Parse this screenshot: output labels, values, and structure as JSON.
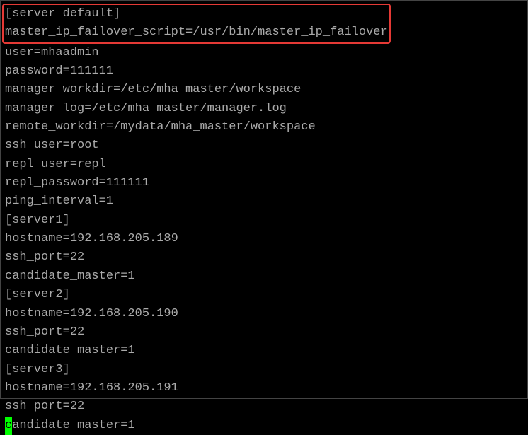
{
  "lines": {
    "l00": "[server default]",
    "l01": "master_ip_failover_script=/usr/bin/master_ip_failover",
    "l02": "user=mhaadmin",
    "l03": "password=111111",
    "l04": "manager_workdir=/etc/mha_master/workspace",
    "l05": "manager_log=/etc/mha_master/manager.log",
    "l06": "remote_workdir=/mydata/mha_master/workspace",
    "l07": "ssh_user=root",
    "l08": "repl_user=repl",
    "l09": "repl_password=111111",
    "l10": "ping_interval=1",
    "l11": "[server1]",
    "l12": "hostname=192.168.205.189",
    "l13": "ssh_port=22",
    "l14": "candidate_master=1",
    "l15": "[server2]",
    "l16": "hostname=192.168.205.190",
    "l17": "ssh_port=22",
    "l18": "candidate_master=1",
    "l19": "[server3]",
    "l20": "hostname=192.168.205.191",
    "l21": "ssh_port=22",
    "l22_cursor": "c",
    "l22_rest": "andidate_master=1"
  }
}
